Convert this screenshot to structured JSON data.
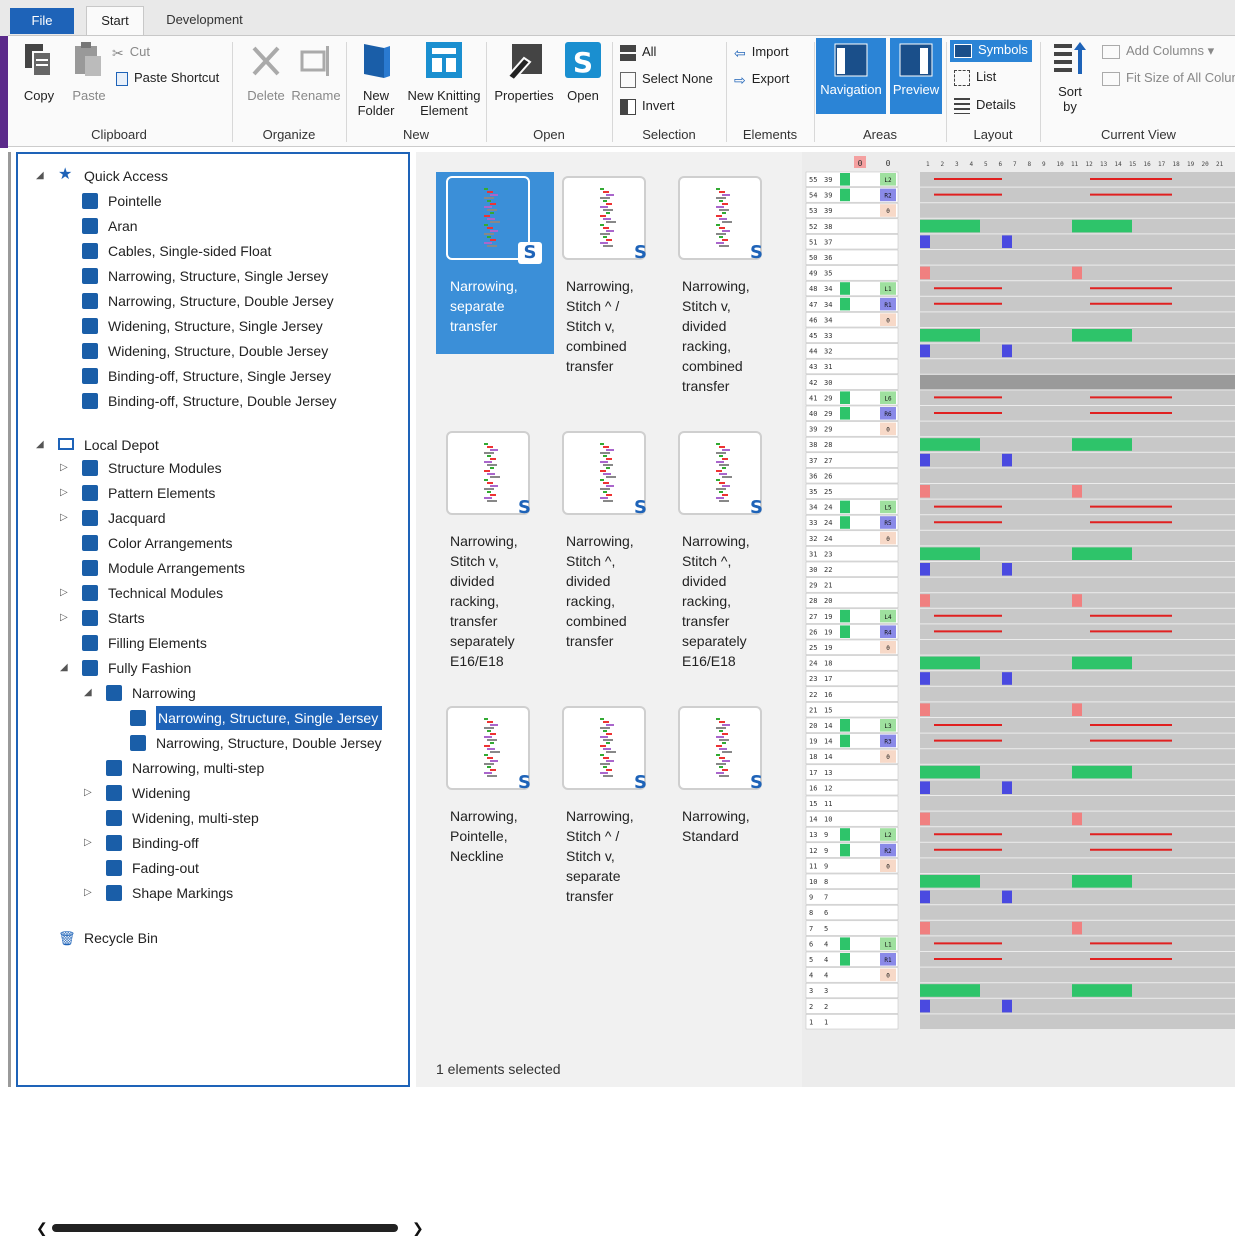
{
  "tabs": {
    "file": "File",
    "start": "Start",
    "development": "Development"
  },
  "ribbon": {
    "clipboard": {
      "label": "Clipboard",
      "copy": "Copy",
      "paste": "Paste",
      "cut": "Cut",
      "paste_shortcut": "Paste Shortcut"
    },
    "organize": {
      "label": "Organize",
      "delete": "Delete",
      "rename": "Rename"
    },
    "new": {
      "label": "New",
      "new_folder": "New Folder",
      "new_knitting_element": "New Knitting Element"
    },
    "open": {
      "label": "Open",
      "properties": "Properties",
      "open": "Open"
    },
    "selection": {
      "label": "Selection",
      "all": "All",
      "select_none": "Select None",
      "invert": "Invert"
    },
    "elements": {
      "label": "Elements",
      "import": "Import",
      "export": "Export"
    },
    "areas": {
      "label": "Areas",
      "navigation": "Navigation",
      "preview": "Preview"
    },
    "layout": {
      "label": "Layout",
      "symbols": "Symbols",
      "list": "List",
      "details": "Details"
    },
    "current_view": {
      "label": "Current View",
      "sort_by": "Sort by",
      "add_columns": "Add Columns",
      "fit_size": "Fit Size of All Colum"
    }
  },
  "tree": {
    "quick_access": "Quick Access",
    "quick_items": [
      "Pointelle",
      "Aran",
      "Cables, Single-sided Float",
      "Narrowing, Structure, Single Jersey",
      "Narrowing, Structure, Double Jersey",
      "Widening, Structure, Single Jersey",
      "Widening, Structure, Double Jersey",
      "Binding-off, Structure, Single Jersey",
      "Binding-off, Structure, Double Jersey"
    ],
    "local_depot": "Local Depot",
    "depot_items": [
      "Structure Modules",
      "Pattern Elements",
      "Jacquard",
      "Color Arrangements",
      "Module Arrangements",
      "Technical Modules",
      "Starts",
      "Filling Elements",
      "Fully Fashion"
    ],
    "fully_fashion_items": [
      "Narrowing"
    ],
    "narrowing_items": [
      "Narrowing, Structure, Single Jersey",
      "Narrowing, Structure, Double Jersey"
    ],
    "ff_more": [
      "Narrowing, multi-step",
      "Widening",
      "Widening, multi-step",
      "Binding-off",
      "Fading-out",
      "Shape Markings"
    ],
    "recycle_bin": "Recycle Bin"
  },
  "elements": [
    {
      "name": "Narrowing, separate transfer"
    },
    {
      "name": "Narrowing, Stitch ^ / Stitch v, combined transfer"
    },
    {
      "name": "Narrowing, Stitch v, divided racking, combined transfer"
    },
    {
      "name": "Narrowing, Stitch v, divided racking, transfer separately E16/E18"
    },
    {
      "name": "Narrowing, Stitch ^, divided racking, combined transfer"
    },
    {
      "name": "Narrowing, Stitch ^, divided racking, transfer separately E16/E18"
    },
    {
      "name": "Narrowing, Pointelle, Neckline"
    },
    {
      "name": "Narrowing, Stitch ^ / Stitch v, separate transfer"
    },
    {
      "name": "Narrowing, Standard"
    }
  ],
  "element_lines": [
    [
      "Narrowing,",
      "separate",
      "transfer"
    ],
    [
      "Narrowing,",
      "Stitch ^ /",
      "Stitch v,",
      "combined",
      "transfer"
    ],
    [
      "Narrowing,",
      "Stitch v,",
      "divided",
      "racking,",
      "combined",
      "transfer"
    ],
    [
      "Narrowing,",
      "Stitch v,",
      "divided",
      "racking,",
      "transfer",
      "separately",
      "E16/E18"
    ],
    [
      "Narrowing,",
      "Stitch ^,",
      "divided",
      "racking,",
      "combined",
      "transfer"
    ],
    [
      "Narrowing,",
      "Stitch ^,",
      "divided",
      "racking,",
      "transfer",
      "separately",
      "E16/E18"
    ],
    [
      "Narrowing,",
      "Pointelle,",
      "Neckline"
    ],
    [
      "Narrowing,",
      "Stitch ^ /",
      "Stitch v,",
      "separate",
      "transfer"
    ],
    [
      "Narrowing,",
      "Standard"
    ]
  ],
  "status": "1 elements selected",
  "preview": {
    "rows": [
      [
        55,
        39,
        "L2"
      ],
      [
        54,
        39,
        "R2"
      ],
      [
        53,
        39,
        "0"
      ],
      [
        52,
        38,
        ""
      ],
      [
        51,
        37,
        ""
      ],
      [
        50,
        36,
        ""
      ],
      [
        49,
        35,
        ""
      ],
      [
        48,
        34,
        "L1"
      ],
      [
        47,
        34,
        "R1"
      ],
      [
        46,
        34,
        "0"
      ],
      [
        45,
        33,
        ""
      ],
      [
        44,
        32,
        ""
      ],
      [
        43,
        31,
        ""
      ],
      [
        42,
        30,
        ""
      ],
      [
        41,
        29,
        "L6"
      ],
      [
        40,
        29,
        "R6"
      ],
      [
        39,
        29,
        "0"
      ],
      [
        38,
        28,
        ""
      ],
      [
        37,
        27,
        ""
      ],
      [
        36,
        26,
        ""
      ],
      [
        35,
        25,
        ""
      ],
      [
        34,
        24,
        "L5"
      ],
      [
        33,
        24,
        "R5"
      ],
      [
        32,
        24,
        "0"
      ],
      [
        31,
        23,
        ""
      ],
      [
        30,
        22,
        ""
      ],
      [
        29,
        21,
        ""
      ],
      [
        28,
        20,
        ""
      ],
      [
        27,
        19,
        "L4"
      ],
      [
        26,
        19,
        "R4"
      ],
      [
        25,
        19,
        "0"
      ],
      [
        24,
        18,
        ""
      ],
      [
        23,
        17,
        ""
      ],
      [
        22,
        16,
        ""
      ],
      [
        21,
        15,
        ""
      ],
      [
        20,
        14,
        "L3"
      ],
      [
        19,
        14,
        "R3"
      ],
      [
        18,
        14,
        "0"
      ],
      [
        17,
        13,
        ""
      ],
      [
        16,
        12,
        ""
      ],
      [
        15,
        11,
        ""
      ],
      [
        14,
        10,
        ""
      ],
      [
        13,
        9,
        "L2"
      ],
      [
        12,
        9,
        "R2"
      ],
      [
        11,
        9,
        "0"
      ],
      [
        10,
        8,
        ""
      ],
      [
        9,
        7,
        ""
      ],
      [
        8,
        6,
        ""
      ],
      [
        7,
        5,
        ""
      ],
      [
        6,
        4,
        "L1"
      ],
      [
        5,
        4,
        "R1"
      ],
      [
        4,
        4,
        "0"
      ],
      [
        3,
        3,
        ""
      ],
      [
        2,
        2,
        ""
      ],
      [
        1,
        1,
        ""
      ]
    ],
    "header_markers": [
      "0",
      "0"
    ],
    "column_numbers": [
      "1",
      "2",
      "3",
      "4",
      "5",
      "6",
      "7",
      "8",
      "9",
      "10",
      "11",
      "12",
      "13",
      "14",
      "15",
      "16",
      "17",
      "18",
      "19",
      "20",
      "21"
    ]
  },
  "colors": {
    "accent": "#1e63b8",
    "selected_card": "#3b8fd8",
    "green": "#2ec46a",
    "red": "#e02020",
    "purple": "#5b2a8a"
  }
}
